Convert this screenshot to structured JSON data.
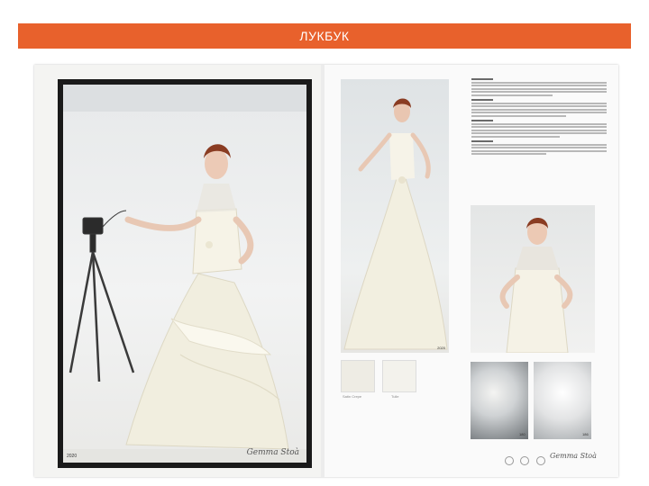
{
  "header": {
    "title": "ЛУКБУК",
    "color": "#e8612c"
  },
  "lookbook": {
    "left_page": {
      "photo_code": "2020",
      "signature": "Gemma Stoà"
    },
    "right_page": {
      "photo_code": "2020",
      "swatches": [
        "Satin Crepe",
        "Tulle"
      ],
      "detail_codes": [
        "180",
        "186"
      ],
      "signature": "Gemma Stoà"
    }
  },
  "colors": {
    "accent": "#e8612c",
    "dress": "#f3f0e2",
    "background": "#ffffff"
  }
}
